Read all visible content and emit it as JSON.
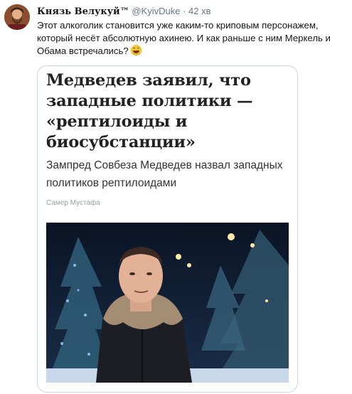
{
  "tweet": {
    "author_name": "Князь Велукуй™",
    "handle": "@KyivDuke",
    "separator": "·",
    "time": "42 хв",
    "text": "Этот алкоголик становится уже каким-то криповым персонажем, который несёт абсолютную ахинею. И как раньше с ним Меркель и Обама встречались?",
    "emoji_icon": "grinning-squinting-face-icon"
  },
  "card": {
    "headline": "Медведев заявил, что западные политики — «рептилоиды и биосубстанции»",
    "subtitle": "Зампред Совбеза Медведев назвал западных политиков рептилоидами",
    "author": "Самер Мустафа"
  },
  "colors": {
    "text": "#14171a",
    "secondary": "#657786",
    "card_border": "#ccd6dd"
  }
}
